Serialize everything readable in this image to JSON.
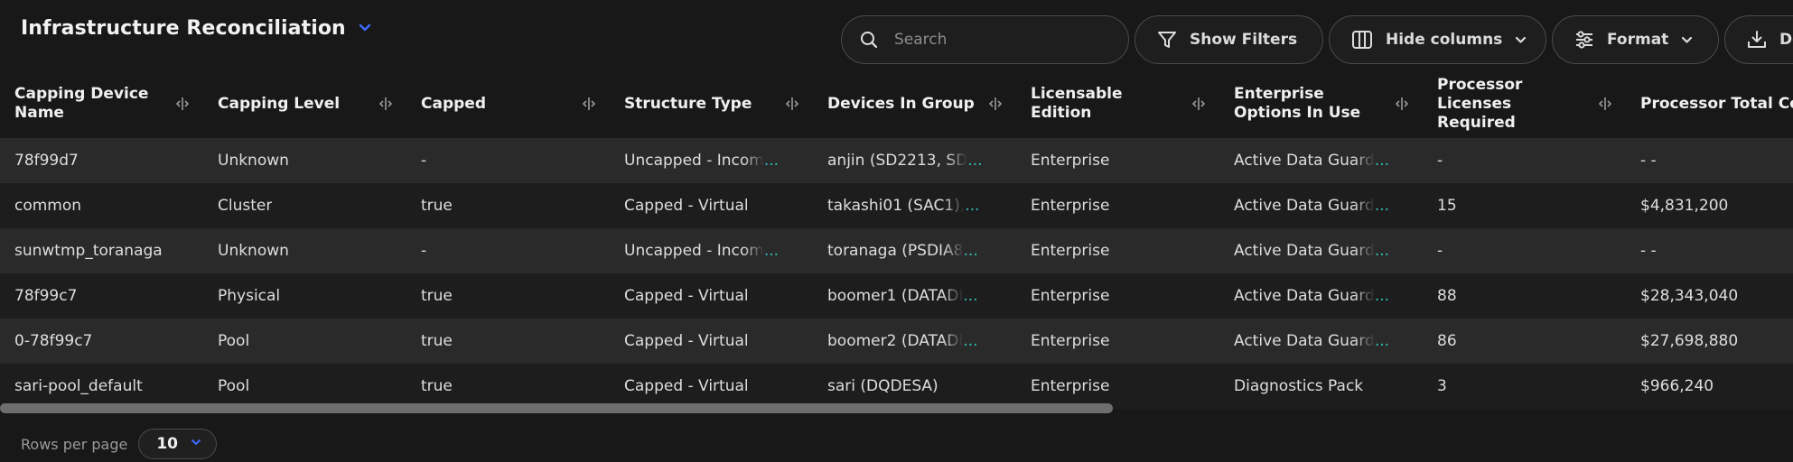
{
  "header": {
    "title": "Infrastructure Reconciliation"
  },
  "toolbar": {
    "search_placeholder": "Search",
    "show_filters": "Show Filters",
    "hide_columns": "Hide columns",
    "format": "Format",
    "download": "Download"
  },
  "table": {
    "columns": [
      "Capping Device Name",
      "Capping Level",
      "Capped",
      "Structure Type",
      "Devices In Group",
      "Licensable Edition",
      "Enterprise Options In Use",
      "Processor Licenses Required",
      "Processor Total Cost"
    ],
    "rows": [
      [
        "78f99d7",
        "Unknown",
        "-",
        "Uncapped - Incom",
        "anjin (SD2213, SD",
        "Enterprise",
        "Active Data Guard",
        "-",
        "- -"
      ],
      [
        "common",
        "Cluster",
        "true",
        "Capped - Virtual",
        "takashi01 (SAC1), ",
        "Enterprise",
        "Active Data Guard",
        "15",
        "$4,831,200"
      ],
      [
        "sunwtmp_toranaga",
        "Unknown",
        "-",
        "Uncapped - Incom",
        "toranaga (PSDIA8",
        "Enterprise",
        "Active Data Guard",
        "-",
        "- -"
      ],
      [
        "78f99c7",
        "Physical",
        "true",
        "Capped - Virtual",
        "boomer1 (DATADI",
        "Enterprise",
        "Active Data Guard",
        "88",
        "$28,343,040"
      ],
      [
        "0-78f99c7",
        "Pool",
        "true",
        "Capped - Virtual",
        "boomer2 (DATADI",
        "Enterprise",
        "Active Data Guard",
        "86",
        "$27,698,880"
      ],
      [
        "sari-pool_default",
        "Pool",
        "true",
        "Capped - Virtual",
        "sari (DQDESA)",
        "Enterprise",
        "Diagnostics Pack",
        "3",
        "$966,240"
      ]
    ],
    "truncated": [
      [
        false,
        false,
        false,
        true,
        true,
        false,
        true,
        false,
        false
      ],
      [
        false,
        false,
        false,
        false,
        true,
        false,
        true,
        false,
        false
      ],
      [
        false,
        false,
        false,
        true,
        true,
        false,
        true,
        false,
        false
      ],
      [
        false,
        false,
        false,
        false,
        true,
        false,
        true,
        false,
        false
      ],
      [
        false,
        false,
        false,
        false,
        true,
        false,
        true,
        false,
        false
      ],
      [
        false,
        false,
        false,
        false,
        false,
        false,
        false,
        false,
        false
      ]
    ],
    "ellipsis": "..."
  },
  "footer": {
    "rows_per_page_label": "Rows per page",
    "rows_per_page_value": "10"
  },
  "colors": {
    "accent": "#3d6bff",
    "ellipsis": "#2ec4b6",
    "row_odd": "#2a2a2a",
    "row_even": "#1d1d1d"
  }
}
